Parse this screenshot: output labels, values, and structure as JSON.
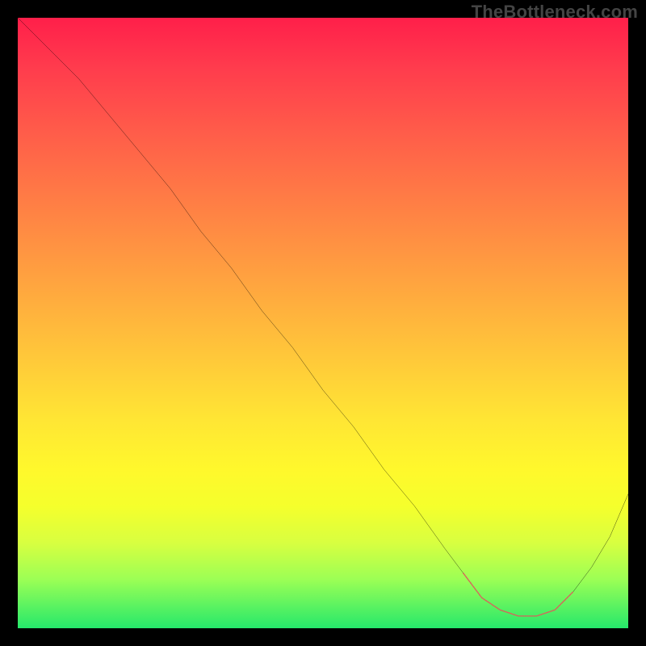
{
  "watermark": "TheBottleneck.com",
  "chart_data": {
    "type": "line",
    "title": "",
    "xlabel": "",
    "ylabel": "",
    "xlim": [
      0,
      100
    ],
    "ylim": [
      0,
      100
    ],
    "grid": false,
    "legend": false,
    "series": [
      {
        "name": "curve",
        "color": "#000000",
        "x": [
          0,
          5,
          10,
          15,
          20,
          25,
          30,
          35,
          40,
          45,
          50,
          55,
          60,
          65,
          70,
          73,
          76,
          79,
          82,
          85,
          88,
          91,
          94,
          97,
          100
        ],
        "y": [
          100,
          95,
          90,
          84,
          78,
          72,
          65,
          59,
          52,
          46,
          39,
          33,
          26,
          20,
          13,
          9,
          5,
          3,
          2,
          2,
          3,
          6,
          10,
          15,
          22
        ]
      },
      {
        "name": "highlight",
        "color": "#d9655c",
        "x": [
          73,
          76,
          79,
          82,
          85,
          88,
          91
        ],
        "y": [
          9,
          5,
          3,
          2,
          2,
          3,
          6
        ]
      }
    ]
  }
}
